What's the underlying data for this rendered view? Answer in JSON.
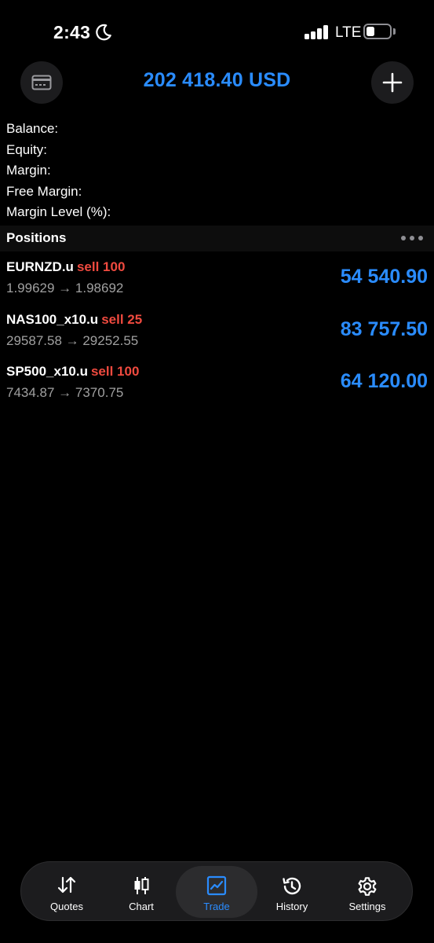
{
  "status": {
    "time": "2:43",
    "network": "LTE"
  },
  "header": {
    "title": "202 418.40 USD"
  },
  "summary": [
    {
      "label": "Balance:"
    },
    {
      "label": "Equity:"
    },
    {
      "label": "Margin:"
    },
    {
      "label": "Free Margin:"
    },
    {
      "label": "Margin Level (%):"
    }
  ],
  "positions": {
    "heading": "Positions",
    "items": [
      {
        "symbol": "EURNZD.u",
        "side": "sell 100",
        "prices": "1.99629 → 1.98692",
        "profit": "54 540.90"
      },
      {
        "symbol": "NAS100_x10.u",
        "side": "sell 25",
        "prices": "29587.58 → 29252.55",
        "profit": "83 757.50"
      },
      {
        "symbol": "SP500_x10.u",
        "side": "sell 100",
        "prices": "7434.87 → 7370.75",
        "profit": "64 120.00"
      }
    ]
  },
  "tabs": [
    {
      "label": "Quotes",
      "icon": "quotes-arrows-icon"
    },
    {
      "label": "Chart",
      "icon": "candlestick-icon"
    },
    {
      "label": "Trade",
      "icon": "trade-chart-icon",
      "active": true
    },
    {
      "label": "History",
      "icon": "history-clock-icon"
    },
    {
      "label": "Settings",
      "icon": "gear-icon"
    }
  ],
  "colors": {
    "accent": "#2a8cff",
    "sell": "#ef4a3f",
    "background": "#000000"
  }
}
